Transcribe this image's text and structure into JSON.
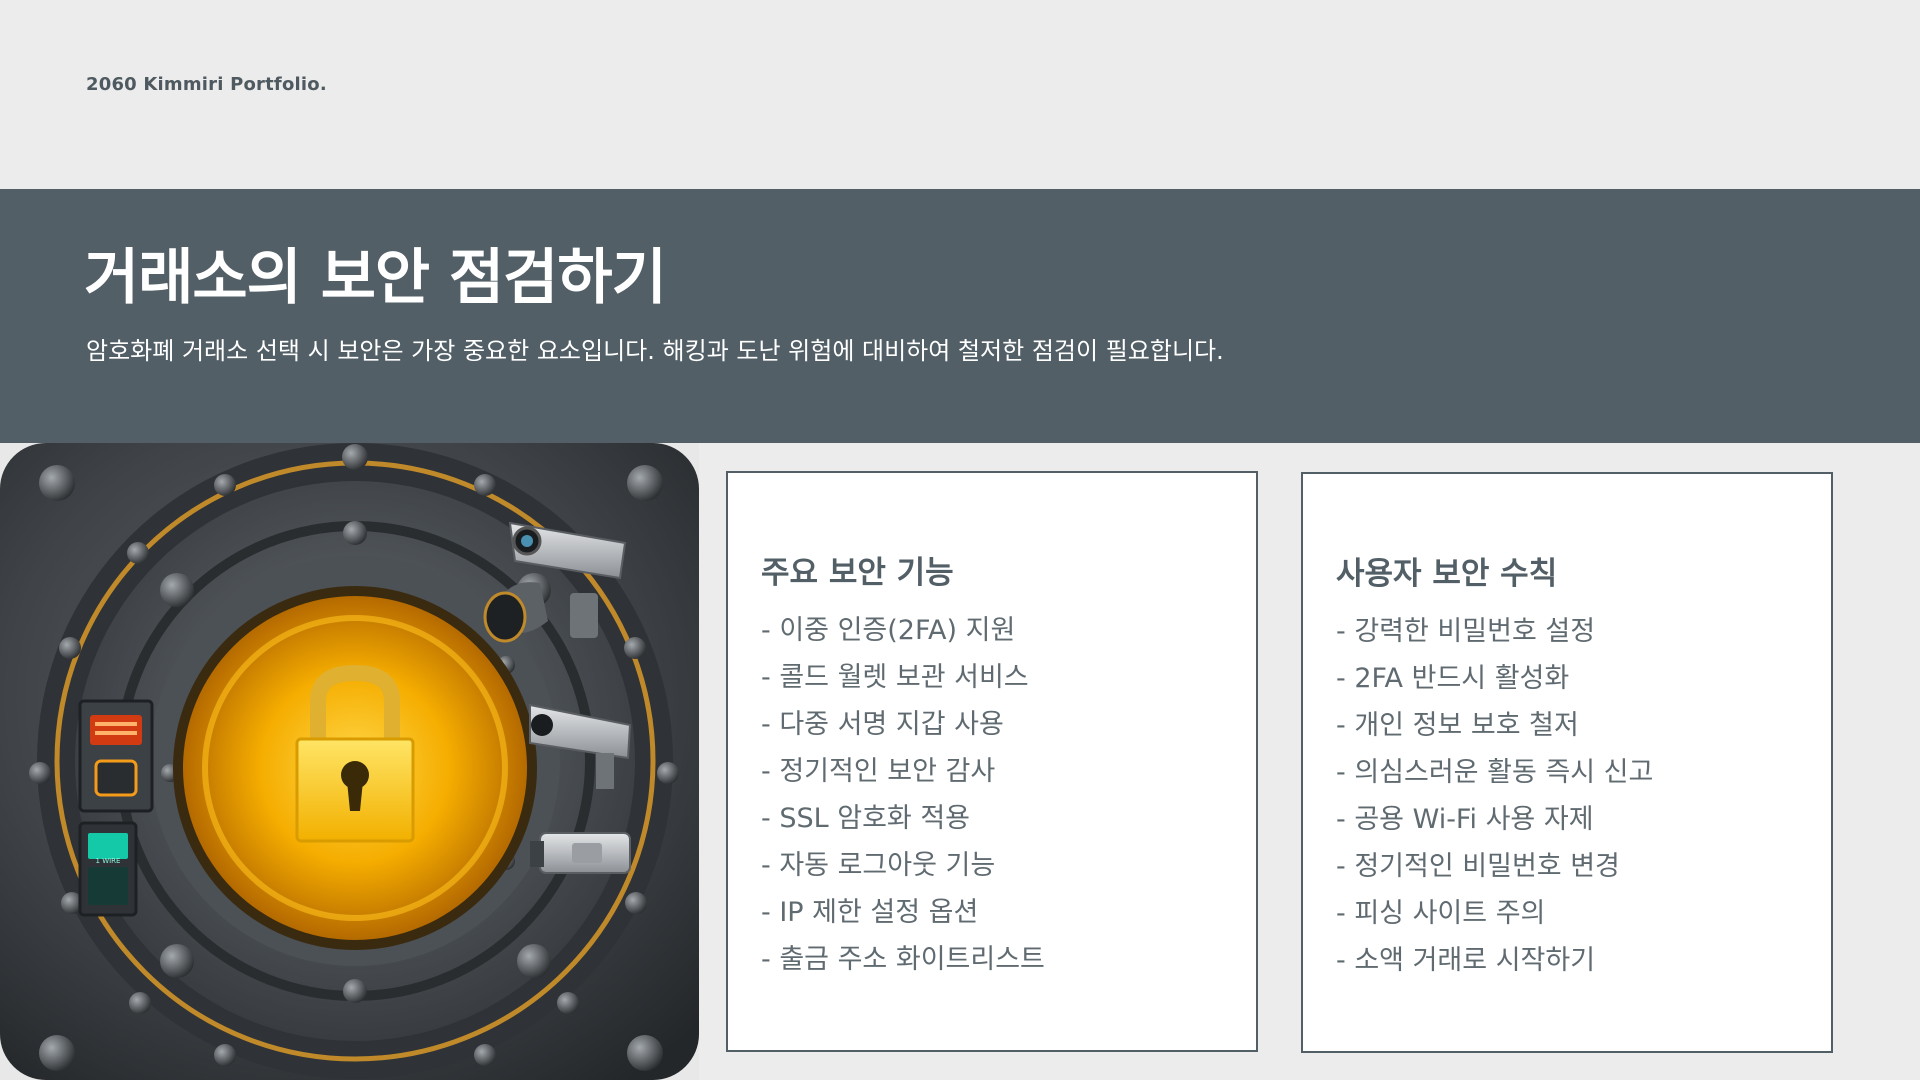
{
  "brand": "2060 Kimmiri Portfolio.",
  "title": "거래소의 보안 점검하기",
  "subtitle": "암호화폐 거래소 선택 시 보안은 가장 중요한 요소입니다. 해킹과 도난 위험에 대비하여 철저한 점검이 필요합니다.",
  "colors": {
    "background": "#ececec",
    "banner": "#525f66",
    "card_border": "#525f66",
    "lock": "#f5b800"
  },
  "image": {
    "icon": "lock-icon",
    "keypad_text": "1 WIRE"
  },
  "cards": [
    {
      "title": "주요 보안 기능",
      "items": [
        "- 이중 인증(2FA) 지원",
        "- 콜드 월렛 보관 서비스",
        "- 다중 서명 지갑 사용",
        "- 정기적인 보안 감사",
        "- SSL 암호화 적용",
        "- 자동 로그아웃 기능",
        "- IP 제한 설정 옵션",
        "- 출금 주소 화이트리스트"
      ]
    },
    {
      "title": "사용자 보안 수칙",
      "items": [
        "- 강력한 비밀번호 설정",
        "- 2FA 반드시 활성화",
        "- 개인 정보 보호 철저",
        "- 의심스러운 활동 즉시 신고",
        "- 공용 Wi-Fi 사용 자제",
        "- 정기적인 비밀번호 변경",
        "- 피싱 사이트 주의",
        "- 소액 거래로 시작하기"
      ]
    }
  ]
}
